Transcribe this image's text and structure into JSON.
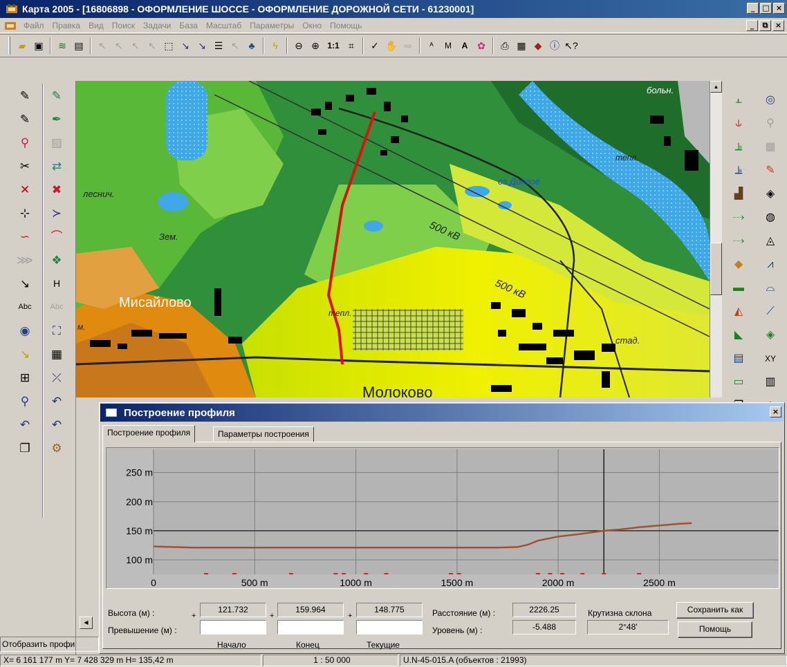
{
  "window": {
    "title": "Карта 2005 - [16806898 - ОФОРМЛЕНИЕ ШОССЕ - ОФОРМЛЕНИЕ ДОРОЖНОЙ СЕТИ - 61230001]",
    "minimize": "_",
    "maximize": "□",
    "close": "×",
    "mdi_minimize": "_",
    "mdi_restore": "⧉",
    "mdi_close": "×"
  },
  "menu": [
    "Файл",
    "Правка",
    "Вид",
    "Поиск",
    "Задачи",
    "База",
    "Масштаб",
    "Параметры",
    "Окно",
    "Помощь"
  ],
  "toolbar": {
    "scale_1_1": "1:1"
  },
  "map": {
    "labels": {
      "bolsh": "больн.",
      "tepl1": "тепл.",
      "oz_dolgoe": "оз.Долгое",
      "lesnich": "леснич.",
      "zem": "Зем.",
      "kv1": "500 кВ",
      "kv2": "500 кВ",
      "misailovo": "Мисайлово",
      "tepl2": "тепл.",
      "stad": "стад.",
      "molokovo": "Молоково",
      "m": "м."
    }
  },
  "dialog": {
    "title": "Построение профиля",
    "close": "×",
    "tabs": [
      "Построение профиля",
      "Параметры построения"
    ],
    "fields": {
      "height_label": "Высота (м) :",
      "excess_label": "Превышение (м) :",
      "distance_label": "Расстояние (м) :",
      "level_label": "Уровень (м) :",
      "steepness_label": "Крутизна склона",
      "height_start": "121.732",
      "height_end": "159.964",
      "height_current": "148.775",
      "distance": "2226.25",
      "level": "-5.488",
      "steepness": "2°48'",
      "start_label": "Начало",
      "end_label": "Конец",
      "current_label": "Текущие",
      "plus": "+"
    },
    "buttons": {
      "save_as": "Сохранить как",
      "help": "Помощь"
    }
  },
  "chart_data": {
    "type": "line",
    "title": "",
    "xlabel": "",
    "ylabel": "",
    "x_ticks": [
      "0",
      "500 m",
      "1000 m",
      "1500 m",
      "2000 m",
      "2500 m"
    ],
    "y_ticks": [
      "100 m",
      "150 m",
      "200 m",
      "250 m"
    ],
    "xlim": [
      0,
      3090
    ],
    "ylim": [
      75,
      290
    ],
    "grid": true,
    "cursor_x": 2226,
    "level_y": 150,
    "series": [
      {
        "color": "#a0522d",
        "x": [
          0,
          200,
          500,
          800,
          1000,
          1200,
          1500,
          1700,
          1800,
          1850,
          1900,
          2000,
          2100,
          2226,
          2300,
          2400,
          2500,
          2600,
          2660
        ],
        "y": [
          123,
          121,
          121,
          121,
          121,
          121,
          121,
          121,
          122,
          126,
          133,
          140,
          144,
          150,
          152,
          156,
          159,
          162,
          163
        ]
      }
    ],
    "markers_x": [
      260,
      400,
      680,
      900,
      940,
      1050,
      1150,
      1470,
      1510,
      1900,
      1960,
      2020,
      2120,
      2226,
      2400
    ]
  },
  "left_panel": {
    "status_text": "Отобразить профи"
  },
  "statusbar": {
    "coords": "X=  6 161 177 m   Y=  7 428 329 m   H= 135,42 m",
    "scale": "1 : 50 000",
    "sheet": "U.N-45-015.A   (объектов : 21993)"
  }
}
